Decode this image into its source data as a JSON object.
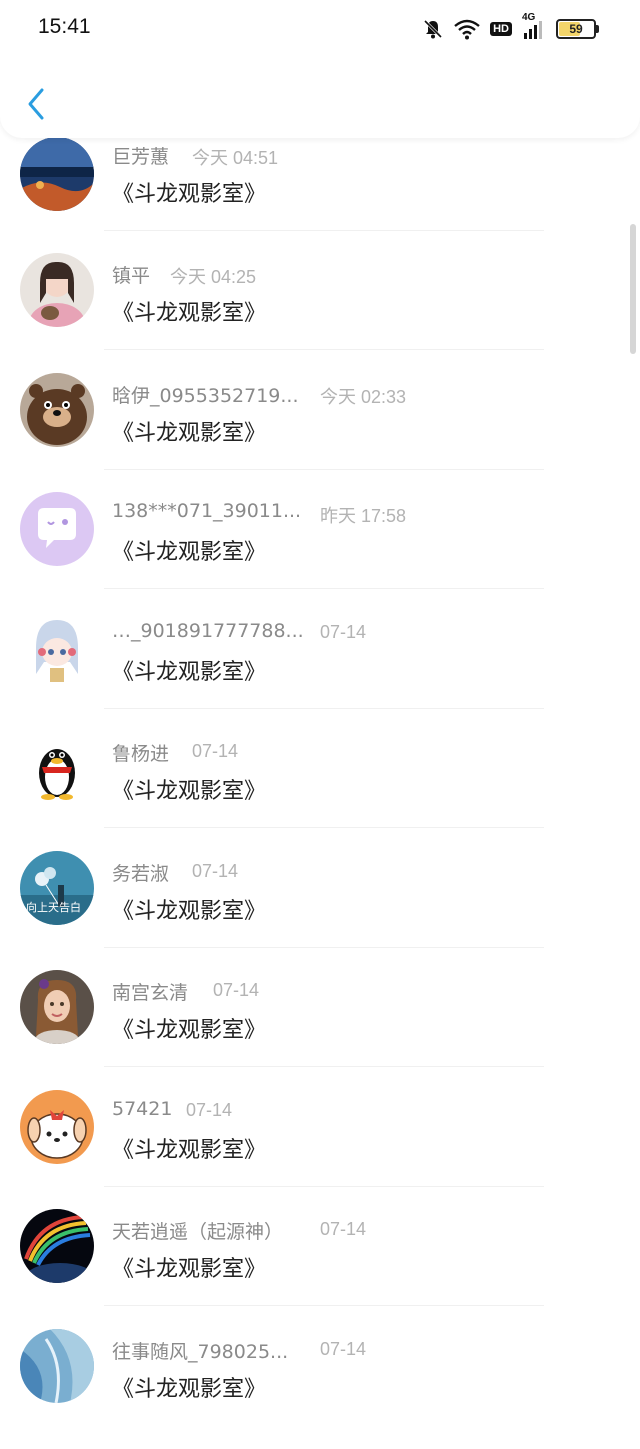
{
  "status_bar": {
    "time": "15:41",
    "battery": "59",
    "network": "4G",
    "hd": "HD"
  },
  "colors": {
    "accent": "#2a9de0",
    "name": "#8a8a8a",
    "time": "#b3b3b3",
    "message": "#222222"
  },
  "messages": [
    {
      "name": "巨芳蕙",
      "time": "今天 04:51",
      "text": "《斗龙观影室》",
      "avatar": "night-sea-photo"
    },
    {
      "name": "镇平",
      "time": "今天 04:25",
      "text": "《斗龙观影室》",
      "avatar": "girl-pink-photo"
    },
    {
      "name": "晗伊_0955352719...",
      "time": "今天 02:33",
      "text": "《斗龙观影室》",
      "avatar": "bear-cartoon"
    },
    {
      "name": "138***071_39011...",
      "time": "昨天 17:58",
      "text": "《斗龙观影室》",
      "avatar": "purple-chat-bubble"
    },
    {
      "name": "…_901891777788...",
      "time": "07-14",
      "text": "《斗龙观影室》",
      "avatar": "anime-girl"
    },
    {
      "name": "鲁杨进",
      "time": "07-14",
      "text": "《斗龙观影室》",
      "avatar": "qq-penguin"
    },
    {
      "name": "务若淑",
      "time": "07-14",
      "text": "《斗龙观影室》",
      "avatar": "balloon-photo",
      "avatar_text": "向上天告白"
    },
    {
      "name": "南宫玄清",
      "time": "07-14",
      "text": "《斗龙观影室》",
      "avatar": "woman-photo"
    },
    {
      "name": "57421",
      "time": "07-14",
      "text": "《斗龙观影室》",
      "avatar": "cartoon-dog"
    },
    {
      "name": "天若逍遥（起源神）",
      "time": "07-14",
      "text": "《斗龙观影室》",
      "avatar": "planet-rainbow"
    },
    {
      "name": "往事随风_798025...",
      "time": "07-14",
      "text": "《斗龙观影室》",
      "avatar": "blue-abstract"
    }
  ]
}
